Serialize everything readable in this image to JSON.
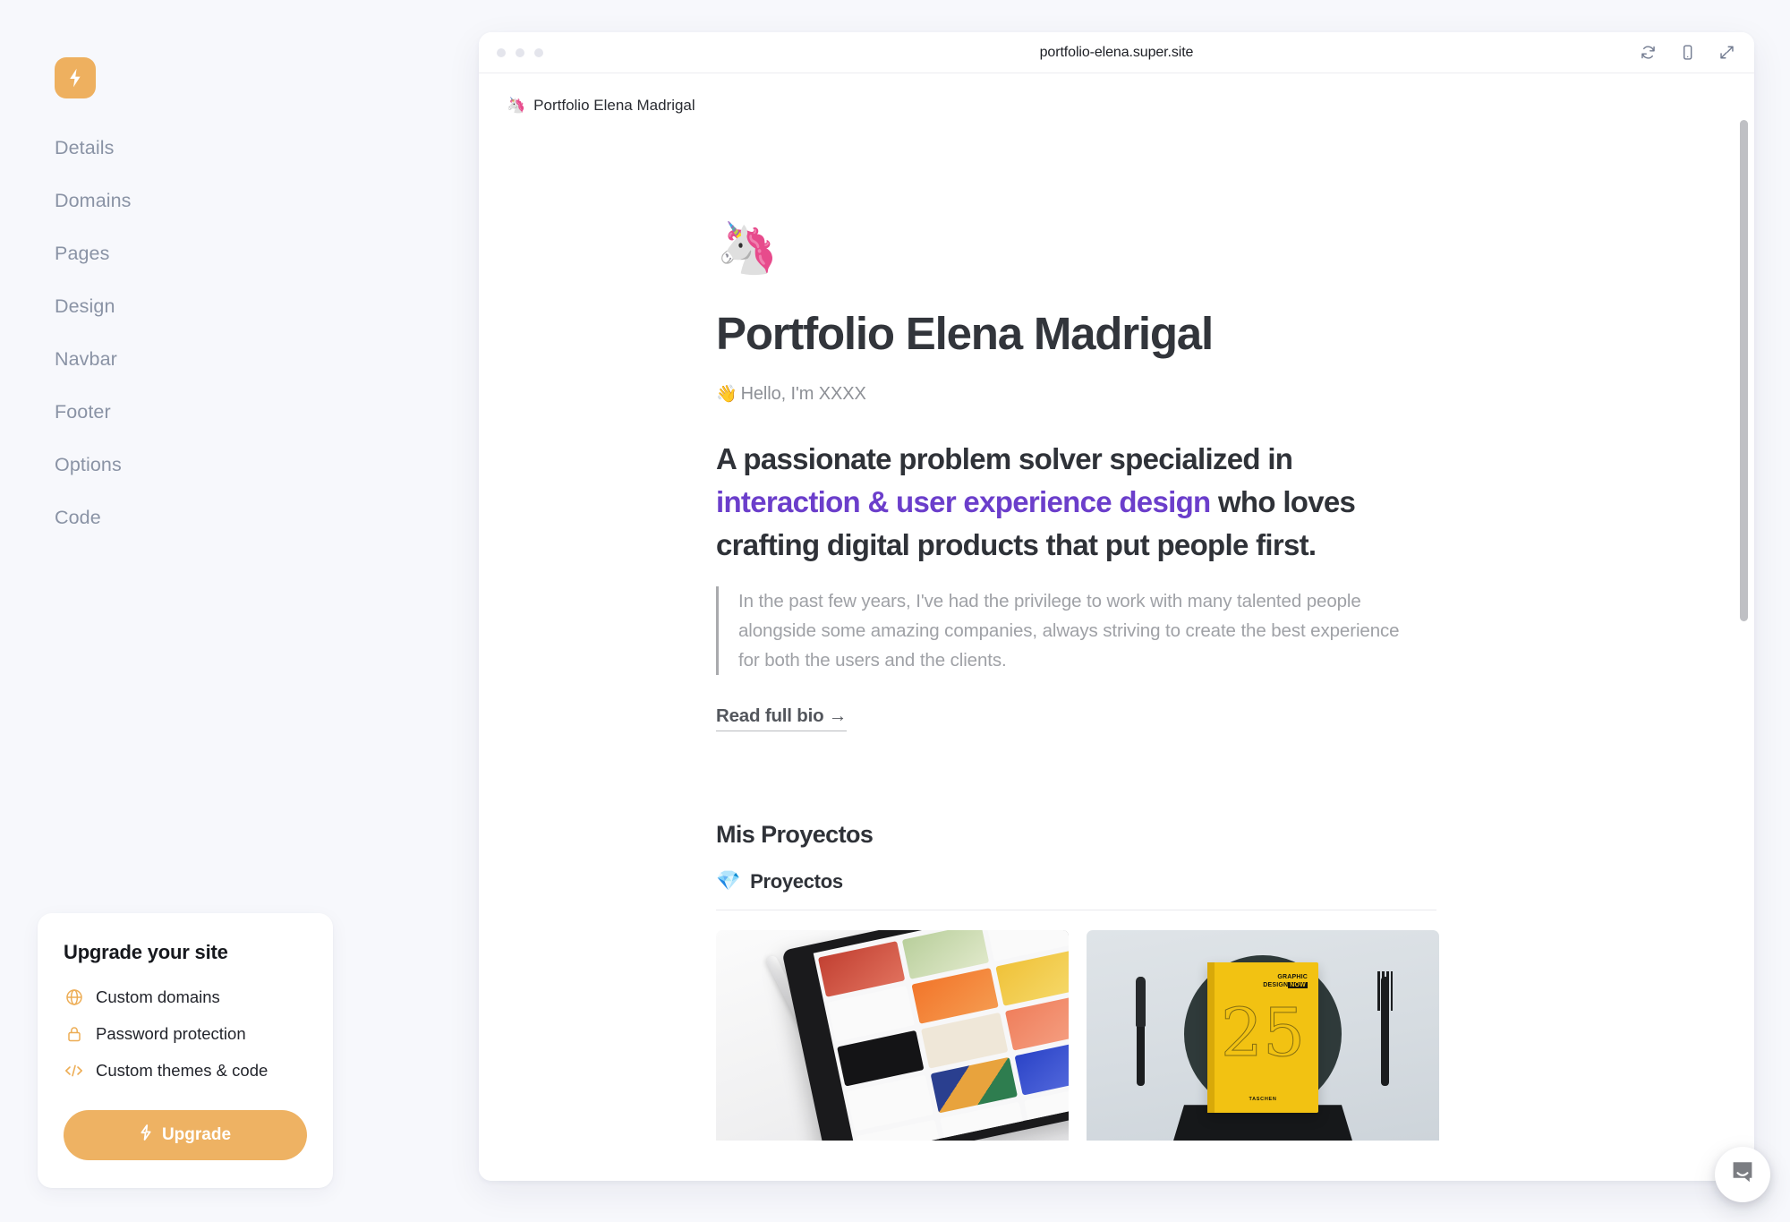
{
  "sidebar": {
    "logo_icon": "lightning-bolt-icon",
    "items": [
      {
        "label": "Details"
      },
      {
        "label": "Domains"
      },
      {
        "label": "Pages"
      },
      {
        "label": "Design"
      },
      {
        "label": "Navbar"
      },
      {
        "label": "Footer"
      },
      {
        "label": "Options"
      },
      {
        "label": "Code"
      }
    ],
    "upgrade_card": {
      "title": "Upgrade your site",
      "features": [
        {
          "icon": "globe-icon",
          "label": "Custom domains"
        },
        {
          "icon": "lock-icon",
          "label": "Password protection"
        },
        {
          "icon": "code-icon",
          "label": "Custom themes & code"
        }
      ],
      "button_label": "Upgrade",
      "button_icon": "lightning-bolt-icon"
    }
  },
  "browser": {
    "url": "portfolio-elena.super.site",
    "actions": [
      {
        "icon": "refresh-icon",
        "name": "refresh"
      },
      {
        "icon": "mobile-icon",
        "name": "mobile-preview"
      },
      {
        "icon": "expand-icon",
        "name": "expand"
      }
    ]
  },
  "site": {
    "breadcrumb_emoji": "🦄",
    "breadcrumb_label": "Portfolio Elena Madrigal",
    "hero_emoji": "🦄",
    "title": "Portfolio Elena Madrigal",
    "greeting_emoji": "👋",
    "greeting": "Hello, I'm XXXX",
    "lead_part1": "A passionate problem solver specialized in ",
    "lead_accent": "interaction & user experience design",
    "lead_part2": " who loves crafting digital products that put people first.",
    "quote": "In the past few years, I've had the privilege to work with many talented people alongside some amazing companies, always striving to create the best experience for both the users and the clients.",
    "read_bio_label": "Read full bio →",
    "projects_heading": "Mis Proyectos",
    "projects_subheading_emoji": "💎",
    "projects_subheading": "Proyectos",
    "projects": [
      {
        "name": "tablet-dribbble-shots",
        "book_title_line1": "",
        "book_title_line2": ""
      },
      {
        "name": "graphic-design-now-book"
      }
    ],
    "project_card_2": {
      "title_line1": "GRAPHIC",
      "title_line2_a": "DESIGN",
      "title_line2_b": "NOW",
      "number": "25",
      "publisher": "TASCHEN"
    }
  },
  "intercom": {
    "icon": "chat-bubble-icon"
  },
  "colors": {
    "brand_amber": "#eeb05f",
    "accent_purple": "#6b3ecb",
    "sidebar_bg": "#f7f8fc",
    "panel_bg": "#ffffff",
    "nav_text": "#8a93a5"
  }
}
